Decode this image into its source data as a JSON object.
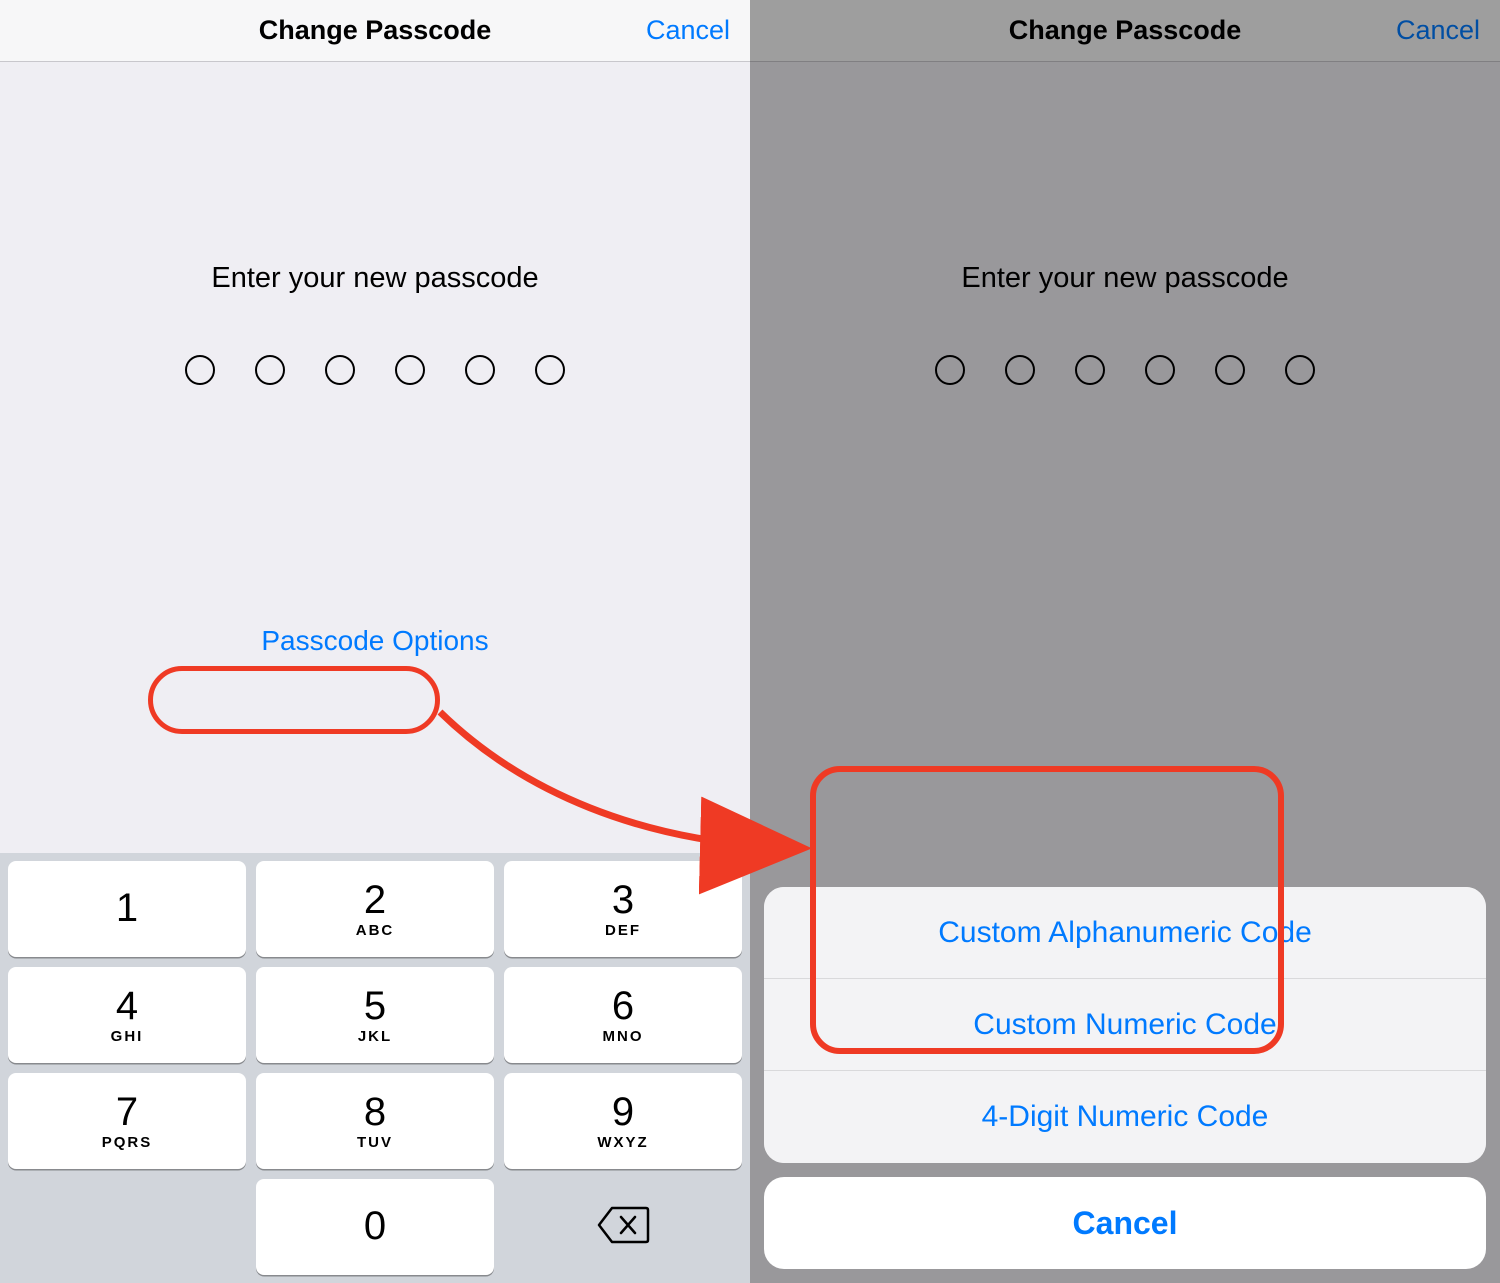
{
  "left": {
    "nav": {
      "title": "Change Passcode",
      "cancel": "Cancel"
    },
    "prompt": "Enter your new passcode",
    "passcode_options": "Passcode Options",
    "keypad": {
      "k1": {
        "d": "1",
        "l": ""
      },
      "k2": {
        "d": "2",
        "l": "ABC"
      },
      "k3": {
        "d": "3",
        "l": "DEF"
      },
      "k4": {
        "d": "4",
        "l": "GHI"
      },
      "k5": {
        "d": "5",
        "l": "JKL"
      },
      "k6": {
        "d": "6",
        "l": "MNO"
      },
      "k7": {
        "d": "7",
        "l": "PQRS"
      },
      "k8": {
        "d": "8",
        "l": "TUV"
      },
      "k9": {
        "d": "9",
        "l": "WXYZ"
      },
      "k0": {
        "d": "0",
        "l": ""
      }
    }
  },
  "right": {
    "nav": {
      "title": "Change Passcode",
      "cancel": "Cancel"
    },
    "prompt": "Enter your new passcode",
    "sheet": {
      "opt1": "Custom Alphanumeric Code",
      "opt2": "Custom Numeric Code",
      "opt3": "4-Digit Numeric Code",
      "cancel": "Cancel"
    }
  }
}
